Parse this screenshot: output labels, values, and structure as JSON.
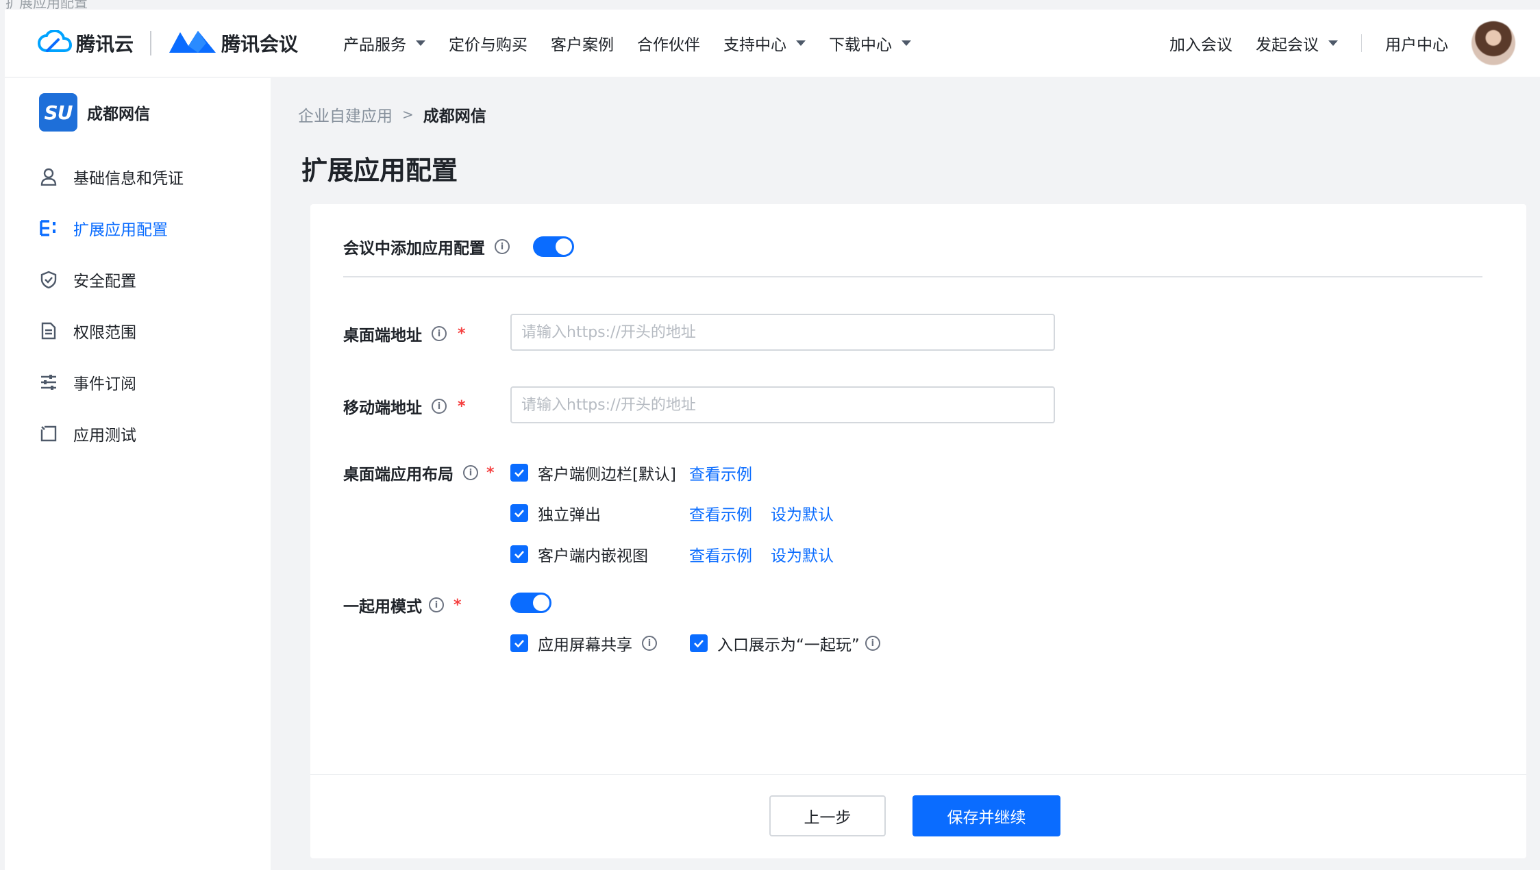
{
  "window": {
    "title": "扩展应用配置"
  },
  "header": {
    "brand_cloud": "腾讯云",
    "brand_meeting": "腾讯会议",
    "nav": [
      {
        "label": "产品服务",
        "dropdown": true
      },
      {
        "label": "定价与购买",
        "dropdown": false
      },
      {
        "label": "客户案例",
        "dropdown": false
      },
      {
        "label": "合作伙伴",
        "dropdown": false
      },
      {
        "label": "支持中心",
        "dropdown": true
      },
      {
        "label": "下载中心",
        "dropdown": true
      }
    ],
    "right": {
      "join": "加入会议",
      "start": "发起会议",
      "user_center": "用户中心"
    }
  },
  "sidebar": {
    "org_logo": "SU",
    "org_name": "成都网信",
    "items": [
      {
        "label": "基础信息和凭证",
        "icon": "user-icon",
        "active": false
      },
      {
        "label": "扩展应用配置",
        "icon": "list-icon",
        "active": true
      },
      {
        "label": "安全配置",
        "icon": "shield-icon",
        "active": false
      },
      {
        "label": "权限范围",
        "icon": "document-icon",
        "active": false
      },
      {
        "label": "事件订阅",
        "icon": "sliders-icon",
        "active": false
      },
      {
        "label": "应用测试",
        "icon": "test-box-icon",
        "active": false
      }
    ]
  },
  "breadcrumb": {
    "parent": "企业自建应用",
    "separator": ">",
    "current": "成都网信"
  },
  "page": {
    "title": "扩展应用配置"
  },
  "form": {
    "meeting_app_label": "会议中添加应用配置",
    "meeting_app_enabled": true,
    "desktop_url": {
      "label": "桌面端地址",
      "placeholder": "请输入https://开头的地址",
      "value": ""
    },
    "mobile_url": {
      "label": "移动端地址",
      "placeholder": "请输入https://开头的地址",
      "value": ""
    },
    "layout": {
      "label": "桌面端应用布局",
      "options": [
        {
          "label": "客户端侧边栏[默认]",
          "checked": true,
          "view_example": "查看示例"
        },
        {
          "label": "独立弹出",
          "checked": true,
          "view_example": "查看示例",
          "set_default": "设为默认"
        },
        {
          "label": "客户端内嵌视图",
          "checked": true,
          "view_example": "查看示例",
          "set_default": "设为默认"
        }
      ]
    },
    "together": {
      "label": "一起用模式",
      "enabled": true,
      "screen_share": {
        "label": "应用屏幕共享",
        "checked": true
      },
      "entry_display": {
        "label": "入口展示为“一起玩”",
        "checked": true
      }
    }
  },
  "footer": {
    "prev": "上一步",
    "save": "保存并继续"
  },
  "colors": {
    "primary": "#0a6cff",
    "required": "#f53f3f"
  }
}
